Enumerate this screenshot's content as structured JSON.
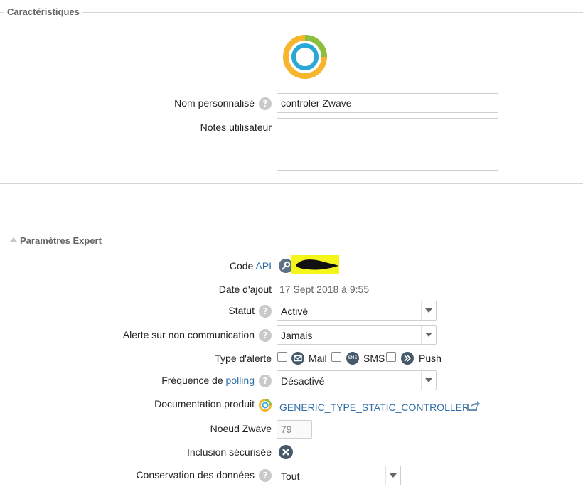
{
  "section_characteristics": {
    "title": "Caractéristiques"
  },
  "form": {
    "custom_name_label": "Nom personnalisé",
    "custom_name_value": "controler Zwave",
    "user_notes_label": "Notes utilisateur",
    "user_notes_value": ""
  },
  "section_expert": {
    "title": "Paramètres Expert"
  },
  "expert": {
    "api_label": "Code",
    "api_link": "API",
    "date_label": "Date d'ajout",
    "date_value": "17 Sept 2018 à 9:55",
    "status_label": "Statut",
    "status_value": "Activé",
    "alert_label": "Alerte sur non communication",
    "alert_value": "Jamais",
    "alert_type_label": "Type d'alerte",
    "alert_types": [
      "Mail",
      "SMS",
      "Push"
    ],
    "sms_badge": "SMS",
    "polling_label_prefix": "Fréquence de",
    "polling_link": "polling",
    "polling_value": "Désactivé",
    "doc_label": "Documentation produit",
    "doc_link": "GENERIC_TYPE_STATIC_CONTROLLER",
    "node_label": "Noeud Zwave",
    "node_value": "79",
    "secure_label": "Inclusion sécurisée",
    "retention_label": "Conservation des données",
    "retention_value": "Tout"
  },
  "help_glyph": "?",
  "colors": {
    "accent_link": "#2e6ea8",
    "ring_yellow": "#f7b52c",
    "ring_green": "#8cbf3f",
    "ring_blue": "#29a8d8",
    "highlight": "#f4f51a"
  },
  "icons": [
    "help-icon",
    "key-icon",
    "mail-icon",
    "sms-icon",
    "push-icon",
    "doc-icon",
    "external-link-icon",
    "cross-icon",
    "collapse-triangle-icon"
  ]
}
